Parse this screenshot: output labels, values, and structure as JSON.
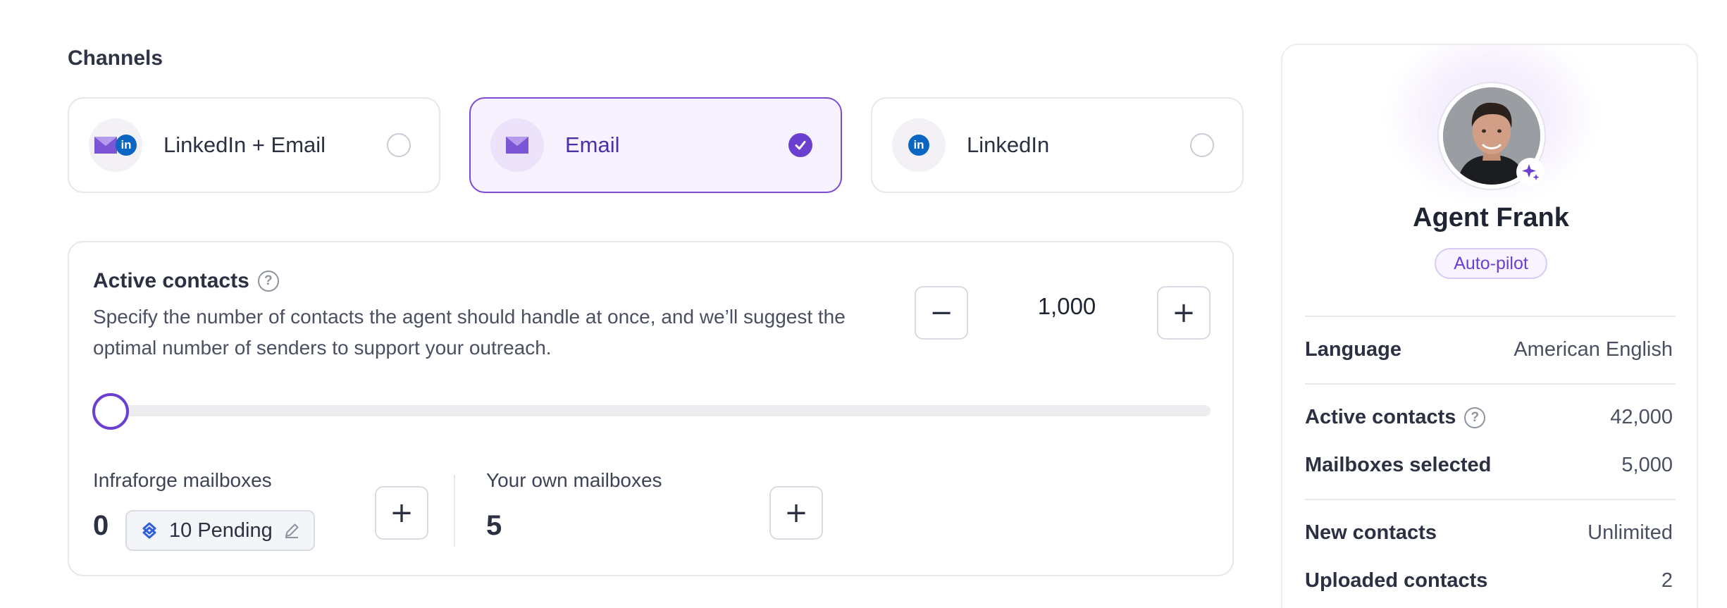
{
  "channels": {
    "title": "Channels",
    "options": [
      {
        "label": "LinkedIn + Email",
        "selected": false
      },
      {
        "label": "Email",
        "selected": true
      },
      {
        "label": "LinkedIn",
        "selected": false
      }
    ],
    "linkedin_glyph": "in"
  },
  "active_contacts": {
    "title": "Active contacts",
    "help_glyph": "?",
    "description": "Specify the number of contacts the agent should handle at once, and we’ll suggest the optimal number of senders to support your outreach.",
    "value": "1,000",
    "slider_level": 0,
    "decrement_glyph": "−",
    "increment_glyph": "+"
  },
  "mailboxes": {
    "infraforge_label": "Infraforge mailboxes",
    "infraforge_value": "0",
    "pending_label": "10 Pending",
    "own_label": "Your own mailboxes",
    "own_value": "5",
    "add_glyph": "+"
  },
  "agent": {
    "name": "Agent Frank",
    "mode": "Auto-pilot",
    "details": [
      {
        "label": "Language",
        "value": "American English"
      },
      {
        "label": "Active contacts",
        "value": "42,000"
      },
      {
        "label": "Mailboxes selected",
        "value": "5,000"
      },
      {
        "label": "New contacts",
        "value": "Unlimited"
      },
      {
        "label": "Uploaded contacts",
        "value": "2"
      }
    ]
  },
  "icons": {
    "email": "envelope-icon",
    "linkedin": "linkedin-icon",
    "check": "check-icon",
    "help": "help-circle-icon",
    "minus": "minus-icon",
    "plus": "plus-icon",
    "pending": "sync-icon",
    "edit": "pencil-icon",
    "sparkle": "sparkle-icon"
  },
  "colors": {
    "accent": "#6b3fd0",
    "linkedin": "#0a66c2",
    "border": "#e6e7ec"
  }
}
